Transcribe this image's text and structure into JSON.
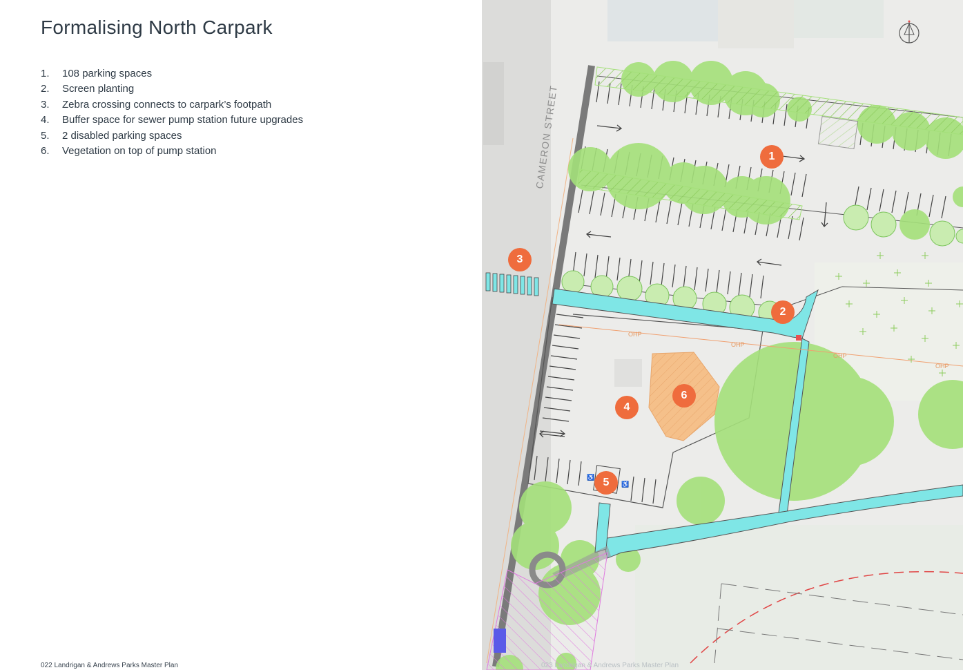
{
  "title": "Formalising North Carpark",
  "items": [
    {
      "num": "1.",
      "text": "108 parking spaces"
    },
    {
      "num": "2.",
      "text": "Screen planting"
    },
    {
      "num": "3.",
      "text": "Zebra crossing connects to carpark’s footpath"
    },
    {
      "num": "4.",
      "text": "Buffer space for sewer pump station future upgrades"
    },
    {
      "num": "5.",
      "text": "2 disabled parking spaces"
    },
    {
      "num": "6.",
      "text": "Vegetation on top of pump station"
    }
  ],
  "footer_left": "022  Landrigan & Andrews Parks Master Plan",
  "footer_right": "023  Landrigan & Andrews Parks Master Plan",
  "map": {
    "street_label": "CAMERON STREET",
    "ohp_label": "OHP",
    "markers": [
      "1",
      "2",
      "3",
      "4",
      "5",
      "6"
    ]
  },
  "colors": {
    "marker": "#ef6c3d",
    "tree_fill": "#a4e07a",
    "path_cyan": "#7fe6e6",
    "pump_area": "#f5c08a",
    "title_text": "#2e3a45"
  },
  "icons": [
    "north-arrow-icon",
    "disabled-parking-icon"
  ]
}
